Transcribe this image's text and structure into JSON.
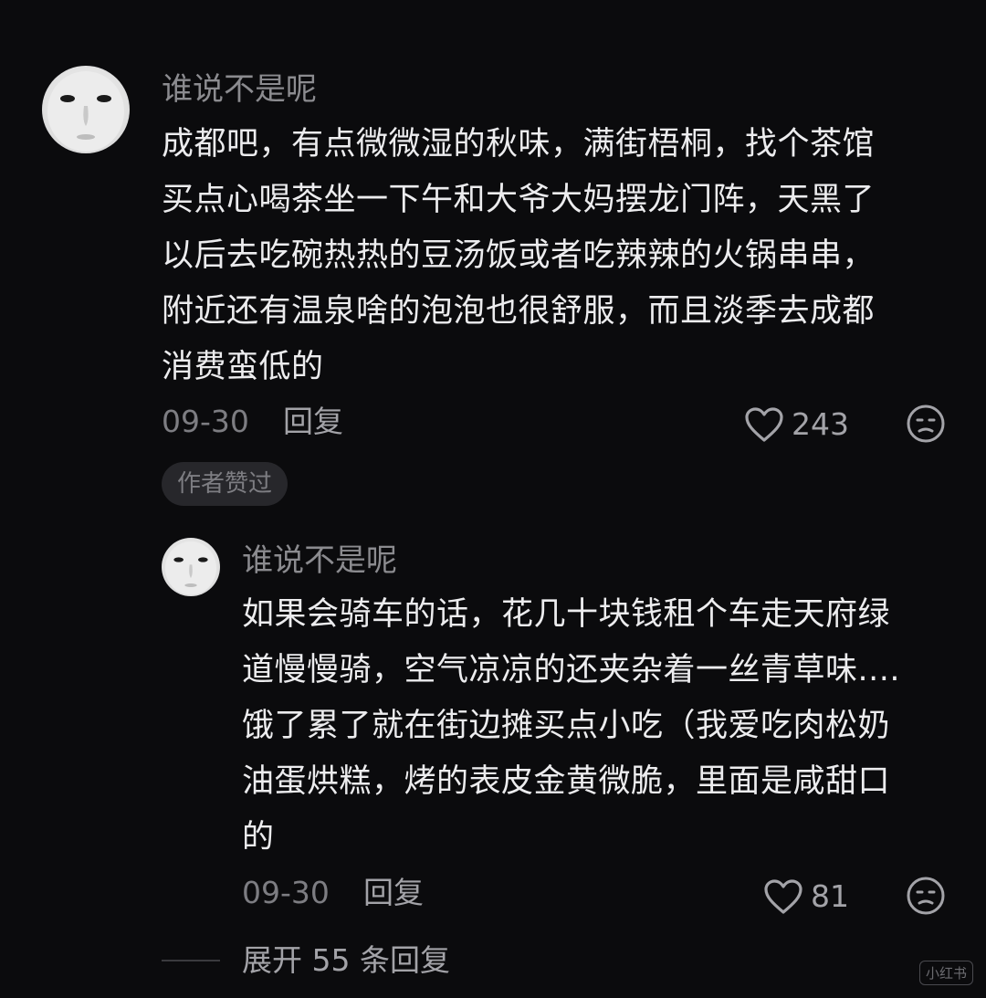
{
  "comment": {
    "username": "谁说不是呢",
    "lines": [
      "成都吧，有点微微湿的秋味，满街梧桐，找个茶馆",
      "买点心喝茶坐一下午和大爷大妈摆龙门阵，天黑了",
      "以后去吃碗热热的豆汤饭或者吃辣辣的火锅串串，",
      "附近还有温泉啥的泡泡也很舒服，而且淡季去成都",
      "消费蛮低的"
    ],
    "date": "09-30",
    "reply_label": "回复",
    "like_count": "243",
    "badge": "作者赞过"
  },
  "reply": {
    "username": "谁说不是呢",
    "lines": [
      "如果会骑车的话，花几十块钱租个车走天府绿",
      "道慢慢骑，空气凉凉的还夹杂着一丝青草味....",
      "饿了累了就在街边摊买点小吃（我爱吃肉松奶",
      "油蛋烘糕，烤的表皮金黄微脆，里面是咸甜口",
      "的"
    ],
    "date": "09-30",
    "reply_label": "回复",
    "like_count": "81"
  },
  "expand_label": "展开 55 条回复",
  "watermark": "小红书",
  "icons": {
    "like": "heart-outline-icon",
    "dislike": "neutral-face-icon"
  },
  "colors": {
    "background": "#0b0b0d",
    "text": "#ececee",
    "muted": "#8b8b8f"
  }
}
